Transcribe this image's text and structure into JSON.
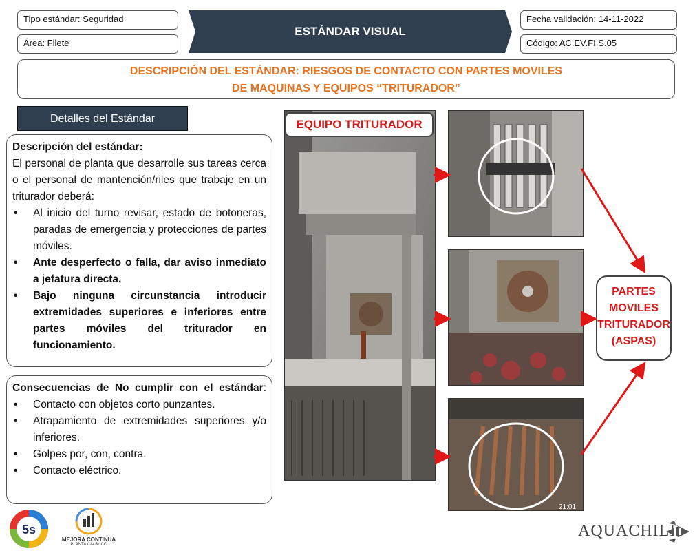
{
  "header": {
    "tipo_estandar": "Tipo estándar: Seguridad",
    "area": "Área: Filete",
    "title": "ESTÁNDAR VISUAL",
    "fecha_validacion": "Fecha validación: 14-11-2022",
    "codigo": "Código: AC.EV.FI.S.05"
  },
  "description": {
    "line1": "DESCRIPCIÓN DEL ESTÁNDAR: RIESGOS DE CONTACTO CON PARTES MOVILES",
    "line2": "DE MAQUINAS Y EQUIPOS “TRITURADOR”"
  },
  "details_tab": "Detalles del Estándar",
  "standard_panel": {
    "heading": "Descripción del estándar:",
    "intro": "El personal de planta que desarrolle sus tareas cerca o el personal de mantención/riles que trabaje en un triturador deberá:",
    "bullets": [
      "Al inicio del turno revisar, estado de botoneras, paradas de emergencia y protecciones de partes móviles.",
      "Ante desperfecto o falla, dar aviso inmediato a jefatura directa.",
      "Bajo ninguna circunstancia introducir extremidades superiores e inferiores entre partes móviles del triturador en funcionamiento."
    ]
  },
  "consequences_panel": {
    "heading": "Consecuencias de No cumplir con el estándar",
    "heading_suffix": ":",
    "bullets": [
      "Contacto con objetos corto punzantes.",
      "Atrapamiento de extremidades superiores y/o inferiores.",
      "Golpes por, con, contra.",
      "Contacto eléctrico."
    ]
  },
  "equipo_label": "EQUIPO TRITURADOR",
  "partes_label": {
    "line1": "PARTES",
    "line2": "MOVILES",
    "line3": "TRITURADOR",
    "line4": "(ASPAS)"
  },
  "photo_timestamp": "21:01",
  "logos": {
    "five_s": "5s",
    "mejora_line1": "MEJORA CONTINUA",
    "mejora_line2": "PLANTA CALBUCO",
    "brand_main": "AQUACHILE"
  },
  "colors": {
    "orange_accent": "#e8731e",
    "red_accent": "#d21d1d",
    "dark_banner": "#2f3f50"
  }
}
